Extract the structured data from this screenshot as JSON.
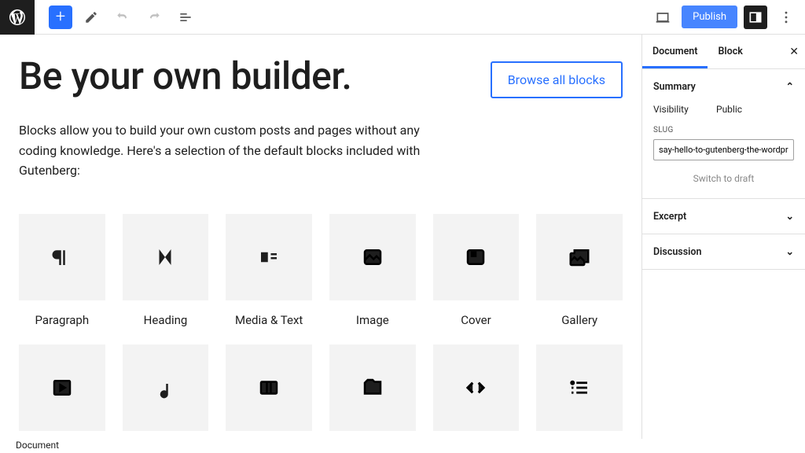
{
  "toolbar": {
    "publish": "Publish"
  },
  "editor": {
    "title": "Be your own builder.",
    "browse": "Browse all blocks",
    "description": "Blocks allow you to build your own custom posts and pages without any coding knowledge. Here's a selection of the default blocks included with Gutenberg:",
    "blocks": [
      {
        "label": "Paragraph"
      },
      {
        "label": "Heading"
      },
      {
        "label": "Media & Text"
      },
      {
        "label": "Image"
      },
      {
        "label": "Cover"
      },
      {
        "label": "Gallery"
      }
    ]
  },
  "sidebar": {
    "tabs": {
      "document": "Document",
      "block": "Block"
    },
    "summary": {
      "title": "Summary",
      "visibility_label": "Visibility",
      "visibility_value": "Public",
      "slug_label": "SLUG",
      "slug_value": "say-hello-to-gutenberg-the-wordpress-ed",
      "switch": "Switch to draft"
    },
    "excerpt": "Excerpt",
    "discussion": "Discussion"
  },
  "breadcrumb": "Document"
}
